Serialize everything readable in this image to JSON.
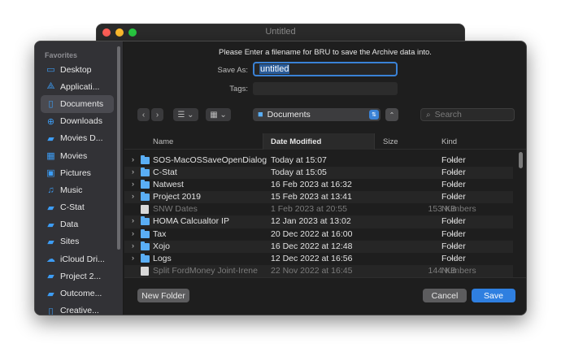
{
  "background_window": {
    "title": "Untitled"
  },
  "sidebar": {
    "section_title": "Favorites",
    "items": [
      {
        "label": "Desktop",
        "icon": "desktop-icon",
        "glyph": "▭"
      },
      {
        "label": "Applicati...",
        "icon": "applications-icon",
        "glyph": "⟁"
      },
      {
        "label": "Documents",
        "icon": "document-icon",
        "glyph": "▯",
        "selected": true
      },
      {
        "label": "Downloads",
        "icon": "download-icon",
        "glyph": "⊕"
      },
      {
        "label": "Movies D...",
        "icon": "folder-icon",
        "glyph": "▰"
      },
      {
        "label": "Movies",
        "icon": "film-icon",
        "glyph": "▦"
      },
      {
        "label": "Pictures",
        "icon": "photo-icon",
        "glyph": "▣"
      },
      {
        "label": "Music",
        "icon": "music-icon",
        "glyph": "♫"
      },
      {
        "label": "C-Stat",
        "icon": "folder-icon",
        "glyph": "▰"
      },
      {
        "label": "Data",
        "icon": "folder-icon",
        "glyph": "▰"
      },
      {
        "label": "Sites",
        "icon": "folder-icon",
        "glyph": "▰"
      },
      {
        "label": "iCloud Dri...",
        "icon": "cloud-icon",
        "glyph": "☁"
      },
      {
        "label": "Project 2...",
        "icon": "folder-icon",
        "glyph": "▰"
      },
      {
        "label": "Outcome...",
        "icon": "folder-icon",
        "glyph": "▰"
      },
      {
        "label": "Creative...",
        "icon": "document-icon",
        "glyph": "▯"
      }
    ]
  },
  "dialog": {
    "prompt": "Please Enter a filename for BRU to save the Archive data into.",
    "save_as_label": "Save As:",
    "save_as_value": "untitled",
    "tags_label": "Tags:"
  },
  "toolbar": {
    "back_glyph": "‹",
    "forward_glyph": "›",
    "list_view_glyph": "☰ ⌄",
    "grid_view_glyph": "▦ ⌄",
    "location": "Documents",
    "stepper_glyph": "⇅",
    "expand_glyph": "⌃",
    "search_glyph": "⌕",
    "search_placeholder": "Search"
  },
  "table": {
    "columns": [
      "Name",
      "Date Modified",
      "Size",
      "Kind"
    ],
    "rows": [
      {
        "name": "SOS-MacOSSaveOpenDialog",
        "date": "Today at 15:07",
        "size": "--",
        "kind": "Folder",
        "folder": true
      },
      {
        "name": "C-Stat",
        "date": "Today at 15:05",
        "size": "--",
        "kind": "Folder",
        "folder": true
      },
      {
        "name": "Natwest",
        "date": "16 Feb 2023 at 16:32",
        "size": "--",
        "kind": "Folder",
        "folder": true
      },
      {
        "name": "Project 2019",
        "date": "15 Feb 2023 at 13:41",
        "size": "--",
        "kind": "Folder",
        "folder": true
      },
      {
        "name": "SNW Dates",
        "date": "1 Feb 2023 at 20:55",
        "size": "153 KB",
        "kind": "Numbers",
        "folder": false
      },
      {
        "name": "HOMA Calcualtor IP",
        "date": "12 Jan 2023 at 13:02",
        "size": "--",
        "kind": "Folder",
        "folder": true
      },
      {
        "name": "Tax",
        "date": "20 Dec 2022 at 16:00",
        "size": "--",
        "kind": "Folder",
        "folder": true
      },
      {
        "name": "Xojo",
        "date": "16 Dec 2022 at 12:48",
        "size": "--",
        "kind": "Folder",
        "folder": true
      },
      {
        "name": "Logs",
        "date": "12 Dec 2022 at 16:56",
        "size": "--",
        "kind": "Folder",
        "folder": true
      },
      {
        "name": "Split FordMoney Joint-Irene",
        "date": "22 Nov 2022 at 16:45",
        "size": "144 KB",
        "kind": "Numbers",
        "folder": false
      }
    ]
  },
  "buttons": {
    "new_folder": "New Folder",
    "cancel": "Cancel",
    "save": "Save"
  },
  "colors": {
    "accent": "#2f7fe0",
    "folder": "#5aaef5",
    "sheet_bg": "#1e1e1e",
    "sidebar_bg": "#323236"
  }
}
